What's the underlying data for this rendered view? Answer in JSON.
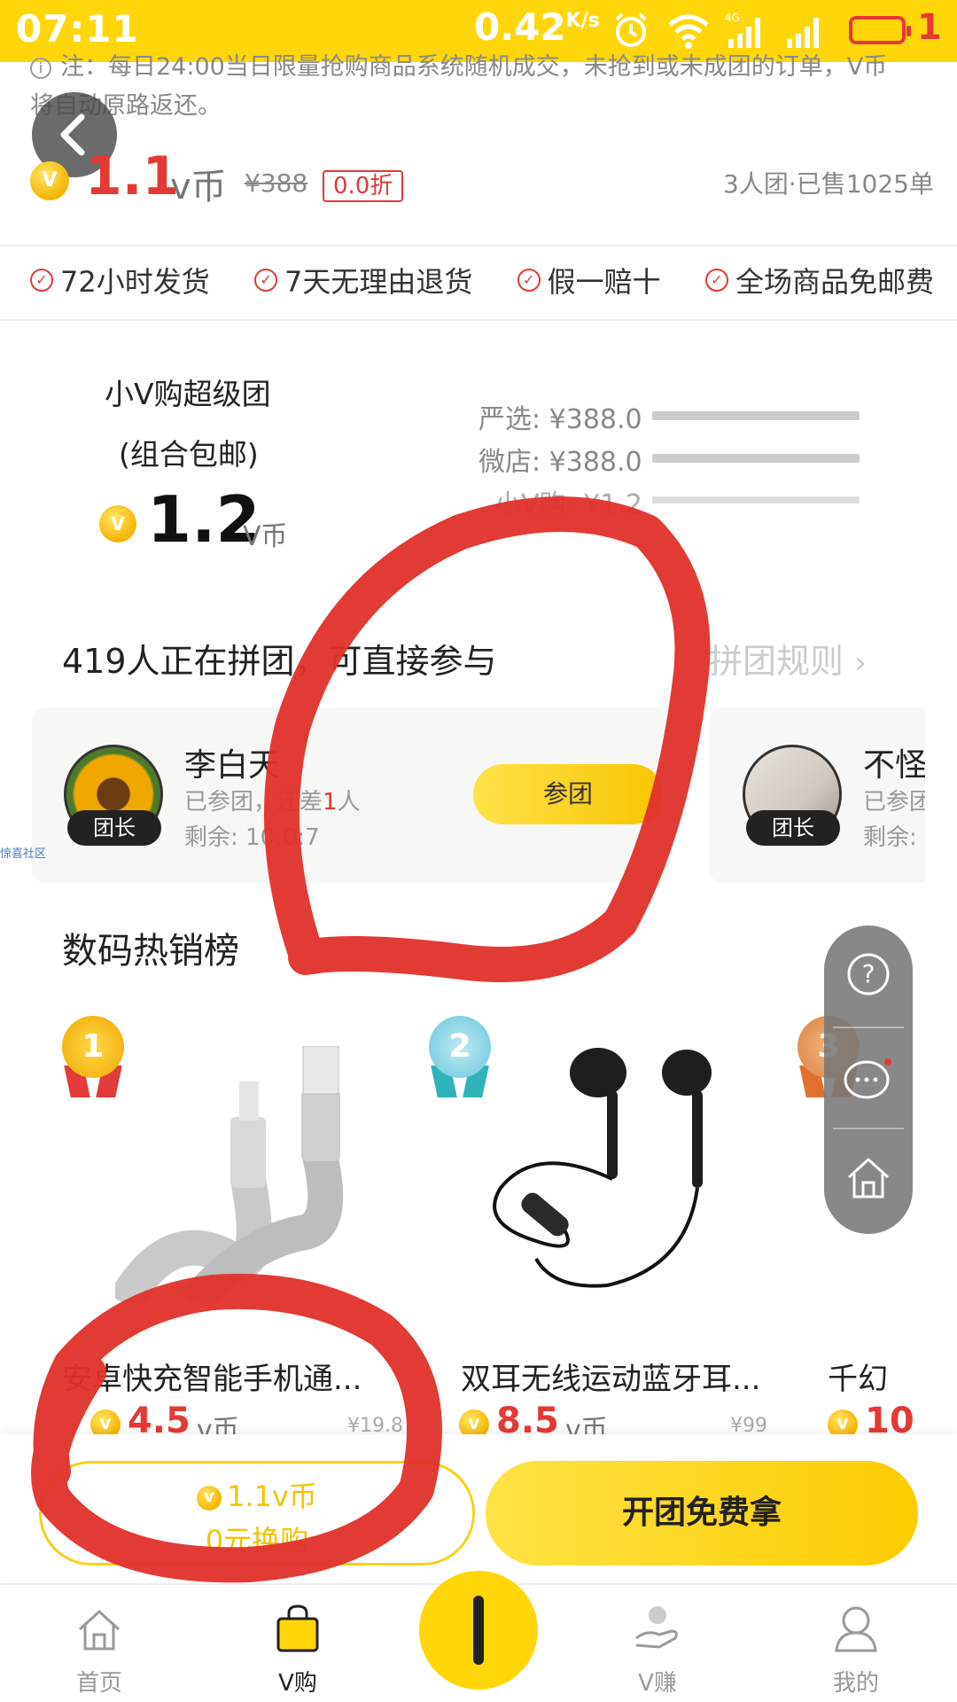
{
  "status_bar": {
    "time": "07:11",
    "network_speed": "0.42",
    "speed_unit": "K/s",
    "battery_level": "1"
  },
  "notice": {
    "icon": "info-icon",
    "text": "注：每日24:00当日限量抢购商品系统随机成交，未抢到或未成团的订单，V币将自动原路返还。"
  },
  "product": {
    "price": "1.1",
    "price_unit": "v币",
    "original_price": "¥388",
    "discount": "0.0折",
    "sales": "3人团·已售1025单"
  },
  "guarantees": [
    "72小时发货",
    "7天无理由退货",
    "假一赔十",
    "全场商品免邮费"
  ],
  "super_group": {
    "title": "小V购超级团",
    "subtitle": "(组合包邮)",
    "price": "1.2",
    "unit": "V币",
    "comparisons": [
      {
        "label": "严选: ¥388.0"
      },
      {
        "label": "微店: ¥388.0"
      },
      {
        "label": "小V购: ¥1.2"
      }
    ]
  },
  "group_buy": {
    "title": "419人正在拼团，可直接参与",
    "rules_link": "拼团规则",
    "teams": [
      {
        "name": "李白天",
        "joined_prefix": "已参团",
        "joined_suffix": "，还差",
        "needed": "1",
        "needed_unit": "人",
        "remaining_label": "剩余:",
        "remaining": "10:0:7",
        "leader_tag": "团长",
        "join_button": "参团"
      },
      {
        "name": "不怪",
        "joined_prefix": "已参团",
        "remaining_label": "剩余:",
        "leader_tag": "团长"
      }
    ],
    "side_text": "惊喜社区"
  },
  "hot_list": {
    "title": "数码热销榜",
    "items": [
      {
        "rank": "1",
        "name": "安卓快充智能手机通...",
        "price": "4.5",
        "unit": "v币",
        "original": "¥19.8"
      },
      {
        "rank": "2",
        "name": "双耳无线运动蓝牙耳...",
        "price": "8.5",
        "unit": "v币",
        "original": "¥99"
      },
      {
        "rank": "3",
        "name": "千幻",
        "price": "10",
        "unit": "v币",
        "original": ""
      }
    ]
  },
  "float_menu": {
    "icons": [
      "help-icon",
      "chat-icon",
      "home-icon"
    ]
  },
  "actions": {
    "exchange_price": "1.1v币",
    "exchange_label": "0元换购",
    "open_group": "开团免费拿"
  },
  "tabbar": {
    "tabs": [
      {
        "label": "首页",
        "icon": "home-icon",
        "active": false
      },
      {
        "label": "V购",
        "icon": "shopping-bag-icon",
        "active": true
      },
      {
        "label": "V赚",
        "icon": "earn-icon",
        "active": false
      },
      {
        "label": "我的",
        "icon": "profile-icon",
        "active": false
      }
    ]
  },
  "colors": {
    "brand_yellow": "#ffd60a",
    "price_red": "#e53935",
    "marker_red": "#e0302a"
  }
}
